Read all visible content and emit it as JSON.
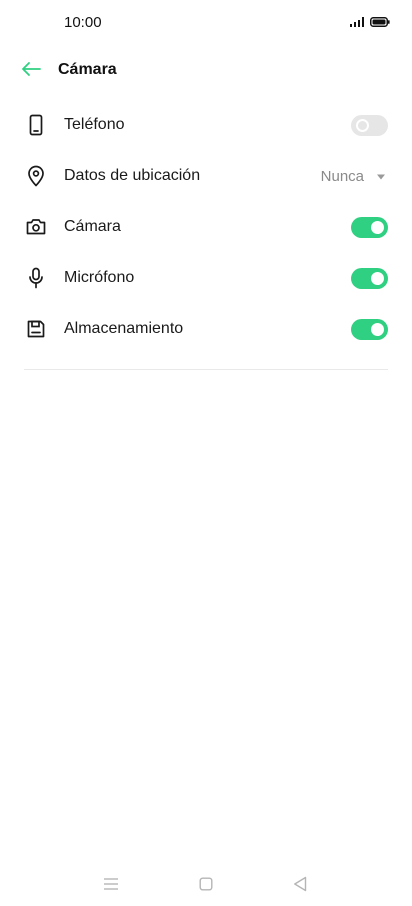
{
  "status_bar": {
    "time": "10:00"
  },
  "header": {
    "title": "Cámara",
    "back_icon": "arrow-left-icon"
  },
  "permissions": [
    {
      "label": "Teléfono",
      "icon": "phone-icon",
      "control": "toggle",
      "enabled": false
    },
    {
      "label": "Datos de ubicación",
      "icon": "location-pin-icon",
      "control": "dropdown",
      "value": "Nunca"
    },
    {
      "label": "Cámara",
      "icon": "camera-icon",
      "control": "toggle",
      "enabled": true
    },
    {
      "label": "Micrófono",
      "icon": "microphone-icon",
      "control": "toggle",
      "enabled": true
    },
    {
      "label": "Almacenamiento",
      "icon": "storage-icon",
      "control": "toggle",
      "enabled": true
    }
  ],
  "colors": {
    "accent": "#2fd081",
    "toggle_off": "#e6e6e6",
    "back_arrow": "#2fd081"
  },
  "nav_bar": {
    "icons": [
      "menu-icon",
      "home-icon",
      "back-icon"
    ]
  }
}
